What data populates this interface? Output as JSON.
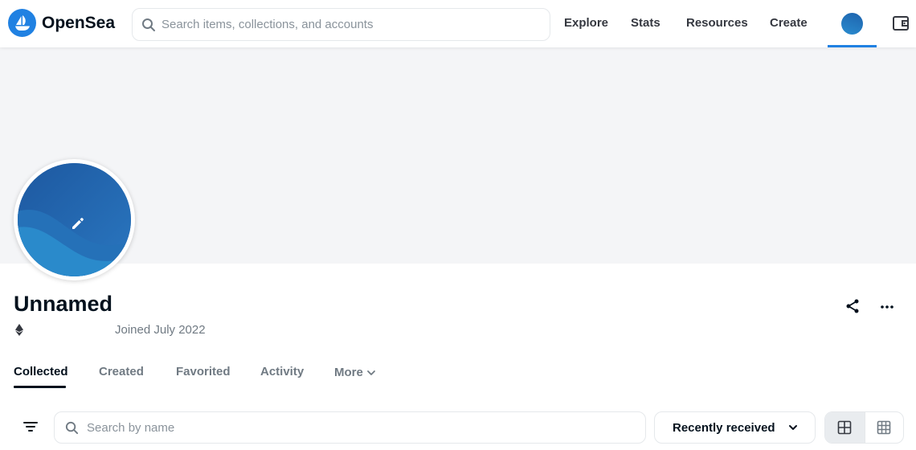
{
  "header": {
    "logo_text": "OpenSea",
    "search_placeholder": "Search items, collections, and accounts",
    "nav": {
      "explore": "Explore",
      "stats": "Stats",
      "resources": "Resources",
      "create": "Create"
    },
    "icons": [
      "opensea-logo-icon",
      "search-icon",
      "user-avatar",
      "wallet-icon"
    ]
  },
  "profile": {
    "name": "Unnamed",
    "address": "",
    "joined": "Joined July 2022",
    "icons": [
      "edit-icon",
      "ethereum-icon",
      "share-icon",
      "more-options-icon"
    ]
  },
  "tabs": {
    "collected": "Collected",
    "created": "Created",
    "favorited": "Favorited",
    "activity": "Activity",
    "more": "More",
    "active": "Collected"
  },
  "toolbar": {
    "search_placeholder": "Search by name",
    "sort_value": "Recently received",
    "view_options": [
      "large-grid-icon",
      "compact-grid-icon"
    ],
    "active_view": "large-grid"
  },
  "colors": {
    "brand": "#2081e2",
    "text_primary": "#04111d",
    "text_secondary": "#707a83",
    "banner_bg": "#f4f5f7",
    "border": "#e5e8eb"
  }
}
